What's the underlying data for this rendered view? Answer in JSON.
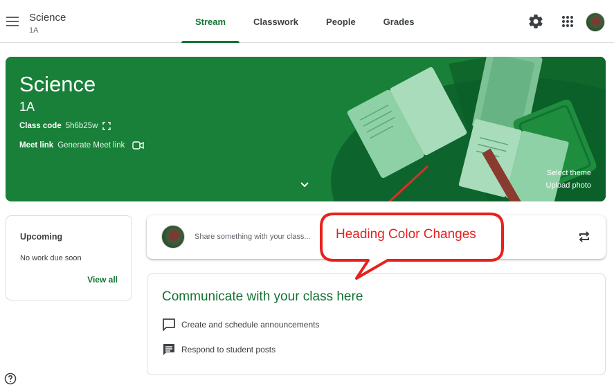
{
  "header": {
    "class_name": "Science",
    "section": "1A",
    "tabs": [
      {
        "label": "Stream",
        "active": true
      },
      {
        "label": "Classwork",
        "active": false
      },
      {
        "label": "People",
        "active": false
      },
      {
        "label": "Grades",
        "active": false
      }
    ],
    "icons": [
      "menu-icon",
      "gear-icon",
      "apps-grid-icon",
      "avatar"
    ]
  },
  "banner": {
    "title": "Science",
    "section": "1A",
    "class_code_label": "Class code",
    "class_code_value": "5h6b25w",
    "meet_link_label": "Meet link",
    "meet_link_value": "Generate Meet link",
    "select_theme": "Select theme",
    "upload_photo": "Upload photo",
    "color": "#188038"
  },
  "upcoming": {
    "title": "Upcoming",
    "empty_text": "No work due soon",
    "view_all": "View all"
  },
  "share": {
    "placeholder": "Share something with your class..."
  },
  "communicate": {
    "title": "Communicate with your class here",
    "items": [
      {
        "label": "Create and schedule announcements",
        "icon": "announcement-icon"
      },
      {
        "label": "Respond to student posts",
        "icon": "comment-icon"
      }
    ]
  },
  "annotation": {
    "text": "Heading Color Changes",
    "color": "#e8211d"
  },
  "colors": {
    "accent": "#137333",
    "banner": "#188038"
  }
}
